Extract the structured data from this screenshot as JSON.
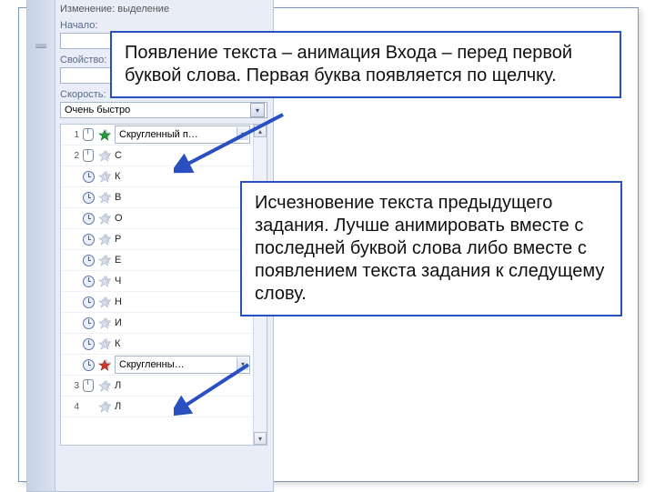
{
  "panel": {
    "header_cut": "Изменение: выделение",
    "start_label": "Начало:",
    "start_value": "",
    "property_label": "Свойство:",
    "property_value": "",
    "speed_label": "Скорость:",
    "speed_value": "Очень быстро"
  },
  "list": [
    {
      "n": "1",
      "trigger": "mouse",
      "star": "green",
      "boxed": true,
      "label": "Скругленный п…"
    },
    {
      "n": "2",
      "trigger": "mouse",
      "star": "faded",
      "boxed": false,
      "label": "С"
    },
    {
      "n": "",
      "trigger": "clock",
      "star": "faded",
      "boxed": false,
      "label": "К"
    },
    {
      "n": "",
      "trigger": "clock",
      "star": "faded",
      "boxed": false,
      "label": "В"
    },
    {
      "n": "",
      "trigger": "clock",
      "star": "faded",
      "boxed": false,
      "label": "О"
    },
    {
      "n": "",
      "trigger": "clock",
      "star": "faded",
      "boxed": false,
      "label": "Р"
    },
    {
      "n": "",
      "trigger": "clock",
      "star": "faded",
      "boxed": false,
      "label": "Е"
    },
    {
      "n": "",
      "trigger": "clock",
      "star": "faded",
      "boxed": false,
      "label": "Ч"
    },
    {
      "n": "",
      "trigger": "clock",
      "star": "faded",
      "boxed": false,
      "label": "Н"
    },
    {
      "n": "",
      "trigger": "clock",
      "star": "faded",
      "boxed": false,
      "label": "И"
    },
    {
      "n": "",
      "trigger": "clock",
      "star": "faded",
      "boxed": false,
      "label": "К"
    },
    {
      "n": "",
      "trigger": "clock",
      "star": "red",
      "boxed": true,
      "label": "Скругленны…"
    },
    {
      "n": "3",
      "trigger": "mouse",
      "star": "faded",
      "boxed": false,
      "label": "Л"
    },
    {
      "n": "4",
      "trigger": "",
      "star": "faded",
      "boxed": false,
      "label": "Л"
    }
  ],
  "callouts": {
    "top": "Появление текста – анимация Входа – перед первой буквой слова. Первая буква появляется по щелчку.",
    "bottom": "Исчезновение текста предыдущего задания. Лучше анимировать вместе с последней буквой слова либо вместе с появлением текста задания к следущему слову."
  }
}
